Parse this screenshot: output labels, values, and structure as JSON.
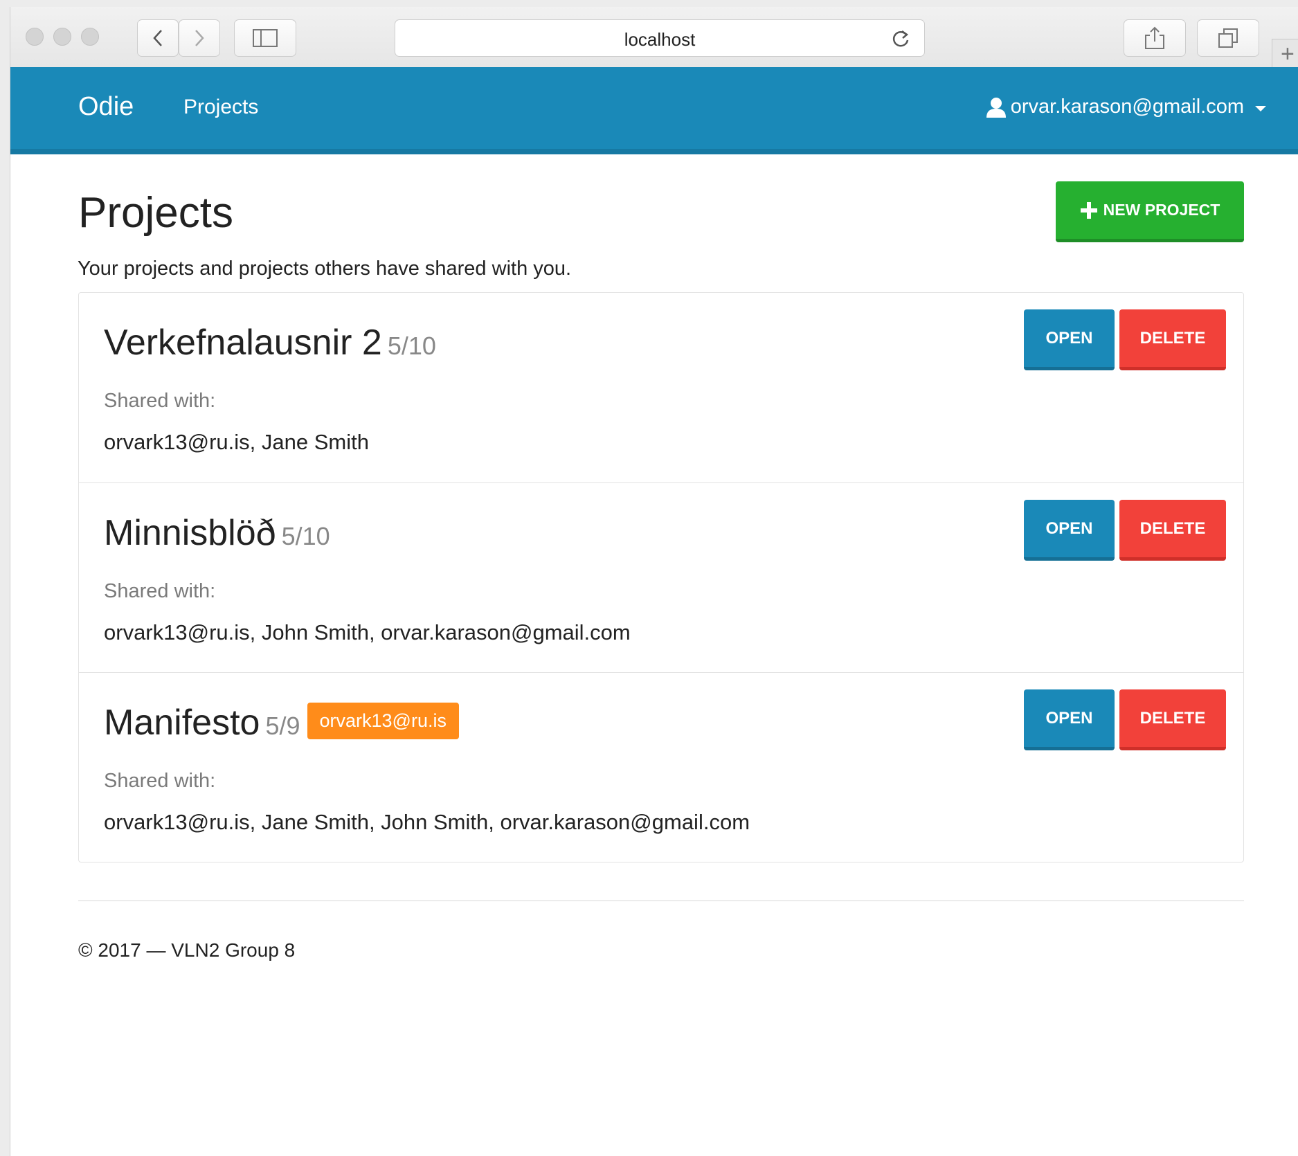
{
  "browser": {
    "url": "localhost",
    "plus_symbol": "+"
  },
  "nav": {
    "brand": "Odie",
    "links": [
      "Projects"
    ],
    "user_email": "orvar.karason@gmail.com"
  },
  "page": {
    "title": "Projects",
    "subtitle": "Your projects and projects others have shared with you.",
    "new_project_label": "NEW PROJECT"
  },
  "projects": [
    {
      "name": "Verkefnalausnir 2",
      "count": "5/10",
      "owner": "",
      "shared_label": "Shared with:",
      "shared_with": "orvark13@ru.is, Jane Smith",
      "open_label": "OPEN",
      "delete_label": "DELETE"
    },
    {
      "name": "Minnisblöð",
      "count": "5/10",
      "owner": "",
      "shared_label": "Shared with:",
      "shared_with": "orvark13@ru.is, John Smith, orvar.karason@gmail.com",
      "open_label": "OPEN",
      "delete_label": "DELETE"
    },
    {
      "name": "Manifesto",
      "count": "5/9",
      "owner": "orvark13@ru.is",
      "shared_label": "Shared with:",
      "shared_with": "orvark13@ru.is, Jane Smith, John Smith, orvar.karason@gmail.com",
      "open_label": "OPEN",
      "delete_label": "DELETE"
    }
  ],
  "footer": {
    "text": "© 2017 — VLN2 Group 8"
  },
  "colors": {
    "navbar": "#1a89b8",
    "new_button": "#26b030",
    "open_button": "#1a89b8",
    "delete_button": "#f2413a",
    "owner_badge": "#ff8c1a"
  }
}
